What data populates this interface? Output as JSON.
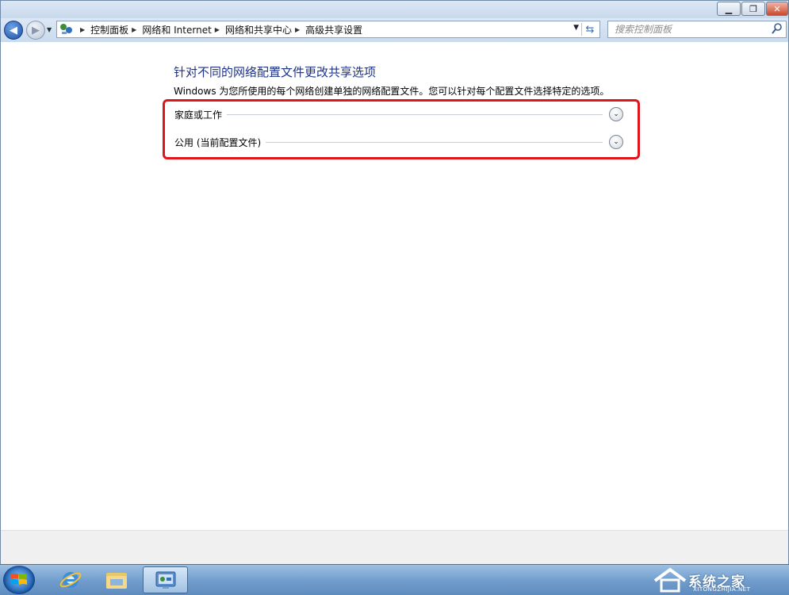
{
  "window": {
    "caption_buttons": {
      "minimize": "▁",
      "maximize": "❐",
      "close": "✕"
    }
  },
  "navigation": {
    "back_icon": "back-arrow-icon",
    "forward_icon": "forward-arrow-icon",
    "breadcrumbs": [
      {
        "label": "控制面板"
      },
      {
        "label": "网络和 Internet"
      },
      {
        "label": "网络和共享中心"
      },
      {
        "label": "高级共享设置"
      }
    ],
    "search_placeholder": "搜索控制面板"
  },
  "main": {
    "heading": "针对不同的网络配置文件更改共享选项",
    "description": "Windows 为您所使用的每个网络创建单独的网络配置文件。您可以针对每个配置文件选择特定的选项。",
    "profiles": [
      {
        "label": "家庭或工作",
        "expanded": false
      },
      {
        "label": "公用 (当前配置文件)",
        "expanded": false
      }
    ],
    "highlight_color": "#e0141b"
  },
  "taskbar": {
    "items": [
      "start-orb",
      "internet-explorer",
      "windows-explorer",
      "control-panel"
    ],
    "watermark": {
      "title": "系统之家",
      "subtitle": "XITONGZHIJIA.NET"
    }
  },
  "colors": {
    "heading": "#1e3287",
    "taskbar": "#6f9ccc"
  }
}
